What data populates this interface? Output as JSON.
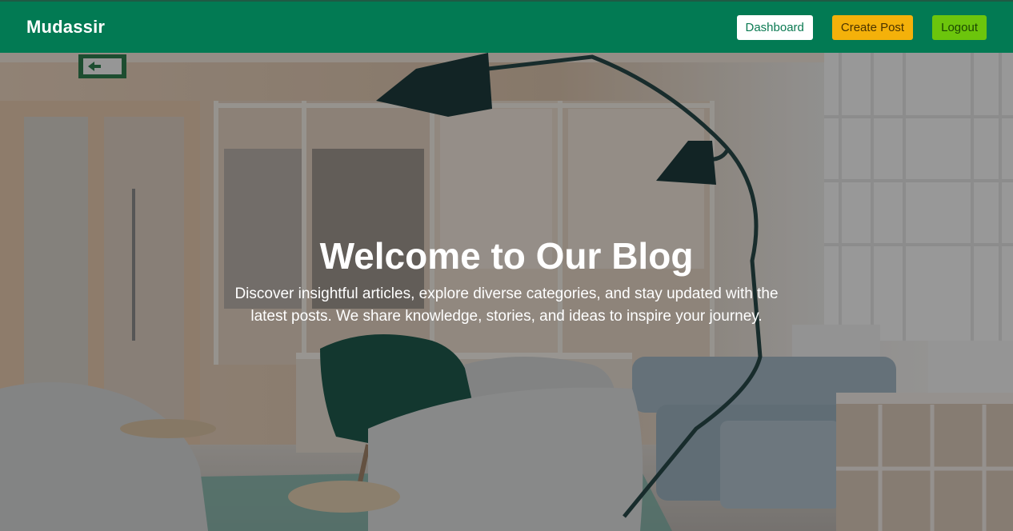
{
  "navbar": {
    "brand": "Mudassir",
    "buttons": {
      "dashboard": "Dashboard",
      "create_post": "Create Post",
      "logout": "Logout"
    },
    "colors": {
      "bar": "#027a53",
      "dashboard": "#ffffff",
      "create_post": "#f4b10a",
      "logout": "#6cc50c"
    }
  },
  "hero": {
    "title": "Welcome to Our Blog",
    "subtitle": "Discover insightful articles, explore diverse categories, and stay updated with the latest posts. We share knowledge, stories, and ideas to inspire your journey.",
    "exit_sign_icon": "exit-sign-icon"
  }
}
